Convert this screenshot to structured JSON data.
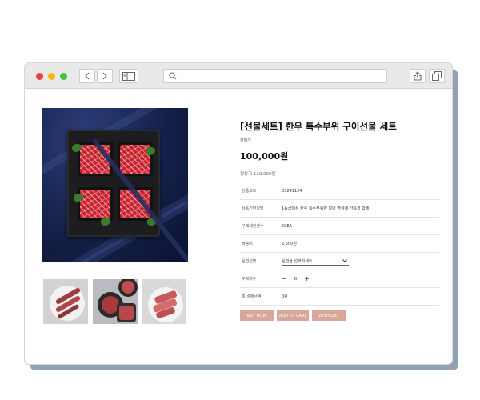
{
  "product": {
    "title": "[선물세트] 한우 특수부위 구이선물 세트",
    "sale_label": "판매가",
    "price": "100,000원",
    "regular_price": "정상가 120,000원"
  },
  "info_rows": [
    {
      "label": "상품코드",
      "value": "33241124"
    },
    {
      "label": "상품간편설명",
      "value": "1등급이상 한우 특수부위만 모아 명절에 가족과 함께"
    },
    {
      "label": "구매제한갯수",
      "value": "50EA"
    },
    {
      "label": "배송비",
      "value": "2,500원"
    },
    {
      "label": "옵션선택",
      "value": "옵션을 선택하세요"
    },
    {
      "label": "구매갯수",
      "value": "0"
    },
    {
      "label": "총 결제금액",
      "value": "0원"
    }
  ],
  "quantity": {
    "minus": "−",
    "value": "0",
    "plus": "+"
  },
  "option_select": {
    "selected": "옵션을 선택하세요"
  },
  "actions": {
    "buy_now": "BUY NOW",
    "add_to_cart": "ADD TO CART",
    "wish_list": "WISH LIST"
  },
  "icons": {
    "back": "chevron-left-icon",
    "forward": "chevron-right-icon",
    "sidebar": "sidebar-icon",
    "search": "search-icon",
    "share": "share-icon",
    "tabs": "tabs-icon"
  },
  "colors": {
    "button": "#d9a79a",
    "close": "#ee4040",
    "minimize": "#f5b915",
    "maximize": "#3ec43e"
  }
}
